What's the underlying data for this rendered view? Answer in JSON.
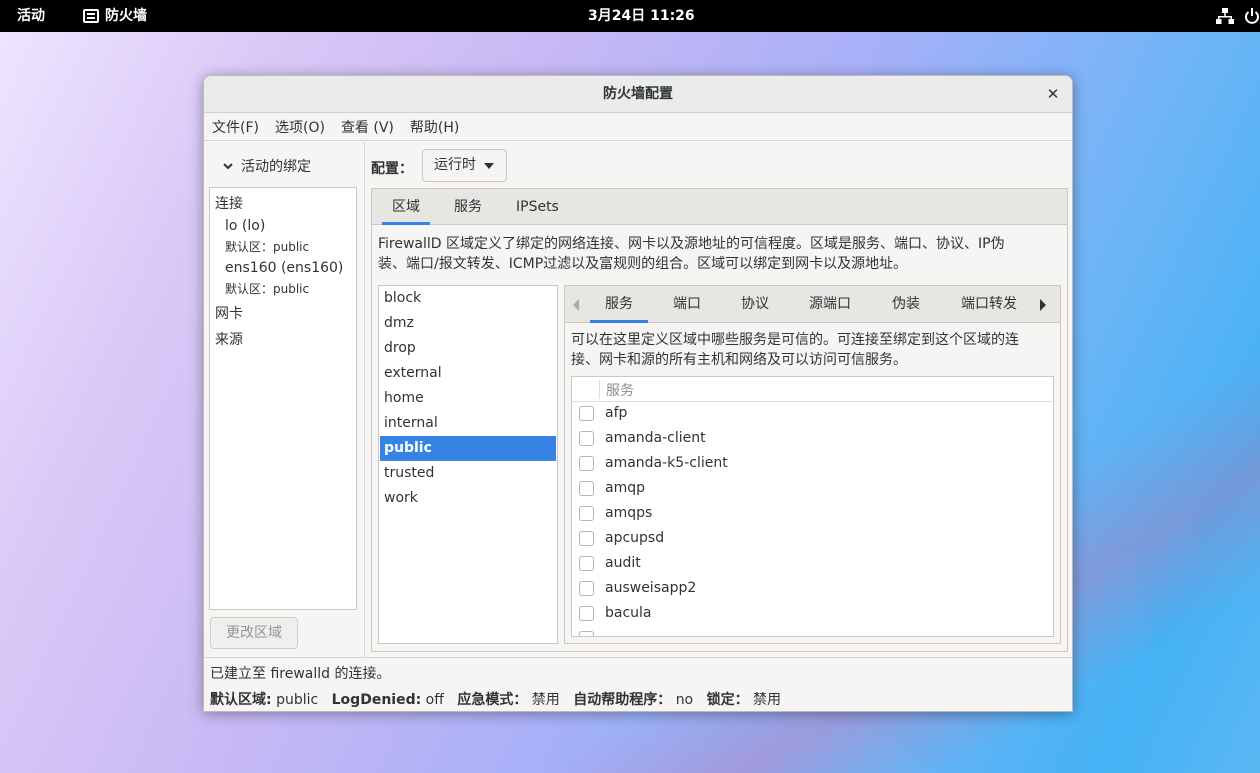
{
  "topbar": {
    "activities": "活动",
    "app_name": "防火墙",
    "clock": "3月24日  11:26",
    "icons": [
      "app-icon",
      "network-icon",
      "power-icon"
    ]
  },
  "window": {
    "title": "防火墙配置",
    "close_glyph": "✕",
    "menu": [
      "文件(F)",
      "选项(O)",
      "查看 (V)",
      "帮助(H)"
    ]
  },
  "sidebar": {
    "expander_label": "活动的绑定",
    "connections_header": "连接",
    "connections": [
      {
        "name": "lo (lo)",
        "zone": "默认区：public"
      },
      {
        "name": "ens160 (ens160)",
        "zone": "默认区：public"
      }
    ],
    "interfaces_header": "网卡",
    "sources_header": "来源",
    "change_zone_button": "更改区域"
  },
  "config": {
    "label": "配置：",
    "value": "运行时"
  },
  "main_tabs": [
    "区域",
    "服务",
    "IPSets"
  ],
  "main_active_tab": "区域",
  "zone_description_line1": "FirewallD 区域定义了绑定的网络连接、网卡以及源地址的可信程度。区域是服务、端口、协议、IP伪",
  "zone_description_line2": "装、端口/报文转发、ICMP过滤以及富规则的组合。区域可以绑定到网卡以及源地址。",
  "zones": [
    "block",
    "dmz",
    "drop",
    "external",
    "home",
    "internal",
    "public",
    "trusted",
    "work"
  ],
  "selected_zone": "public",
  "zone_tabs": [
    "服务",
    "端口",
    "协议",
    "源端口",
    "伪装",
    "端口转发"
  ],
  "zone_active_tab": "服务",
  "services_description_line1": "可以在这里定义区域中哪些服务是可信的。可连接至绑定到这个区域的连",
  "services_description_line2": "接、网卡和源的所有主机和网络及可以访问可信服务。",
  "services_column_header": "服务",
  "services": [
    "afp",
    "amanda-client",
    "amanda-k5-client",
    "amqp",
    "amqps",
    "apcupsd",
    "audit",
    "ausweisapp2",
    "bacula"
  ],
  "status": {
    "connection": "已建立至 firewalld 的连接。",
    "default_zone_label": "默认区域:",
    "default_zone_value": "public",
    "log_denied_label": "LogDenied:",
    "log_denied_value": "off",
    "panic_label": "应急模式：",
    "panic_value": "禁用",
    "helper_label": "自动帮助程序：",
    "helper_value": "no",
    "lockdown_label": "锁定：",
    "lockdown_value": "禁用"
  },
  "colors": {
    "accent": "#3584e4",
    "topbar": "#000000"
  }
}
